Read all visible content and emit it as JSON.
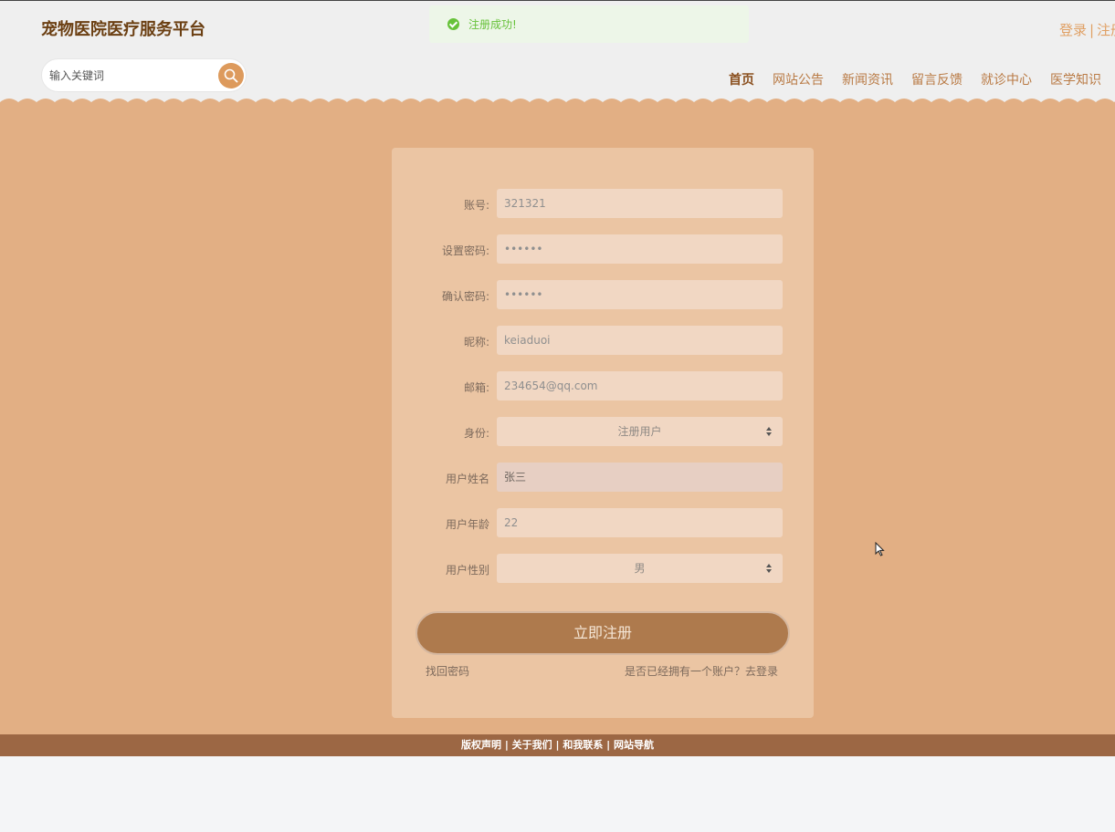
{
  "header": {
    "site_title": "宠物医院医疗服务平台",
    "login_label": "登录",
    "separator": "|",
    "register_label": "注册",
    "search": {
      "placeholder": "输入关键词",
      "icon": "search-icon"
    },
    "nav": [
      "首页",
      "网站公告",
      "新闻资讯",
      "留言反馈",
      "就诊中心",
      "医学知识"
    ],
    "active_nav": "首页"
  },
  "toast": {
    "icon": "check-circle-icon",
    "message": "注册成功!"
  },
  "form": {
    "fields": [
      {
        "label": "账号:",
        "value": "321321"
      },
      {
        "label": "设置密码:",
        "value": "••••••"
      },
      {
        "label": "确认密码:",
        "value": "••••••"
      },
      {
        "label": "昵称:",
        "value": "keiaduoi"
      },
      {
        "label": "邮箱:",
        "value": "234654@qq.com"
      },
      {
        "label": "身份:",
        "value": "注册用户"
      },
      {
        "label": "用户姓名",
        "value": "张三"
      },
      {
        "label": "用户年龄",
        "value": "22"
      },
      {
        "label": "用户性别",
        "value": "男"
      }
    ],
    "submit_label": "立即注册",
    "forgot_label": "找回密码",
    "login_prompt": "是否已经拥有一个账户？去登录"
  },
  "footer": {
    "text": "版权声明 | 关于我们 | 和我联系 | 网站导航"
  },
  "colors": {
    "accent": "#ae7a4d",
    "background": "#e2af84",
    "card": "#ebc5a3",
    "footer": "#9c6744",
    "success": "#67c23a"
  }
}
